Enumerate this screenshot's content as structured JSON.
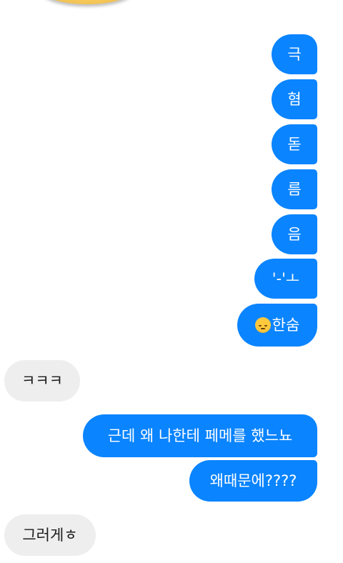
{
  "conversation": {
    "sticker": "sticker-image",
    "messages": [
      {
        "sender": "me",
        "text": "극"
      },
      {
        "sender": "me",
        "text": "혐"
      },
      {
        "sender": "me",
        "text": "돋"
      },
      {
        "sender": "me",
        "text": "름"
      },
      {
        "sender": "me",
        "text": "음"
      },
      {
        "sender": "me",
        "text": "'-'ㅗ"
      },
      {
        "sender": "me",
        "emoji": "pensive-face-icon",
        "text": "한숨"
      },
      {
        "sender": "other",
        "text": "ㅋㅋㅋ"
      },
      {
        "sender": "me",
        "text": "근데 왜 나한테 페메를 했느뇨"
      },
      {
        "sender": "me",
        "text": "왜때문에????"
      },
      {
        "sender": "other",
        "text": "그러게ㅎ"
      }
    ]
  }
}
